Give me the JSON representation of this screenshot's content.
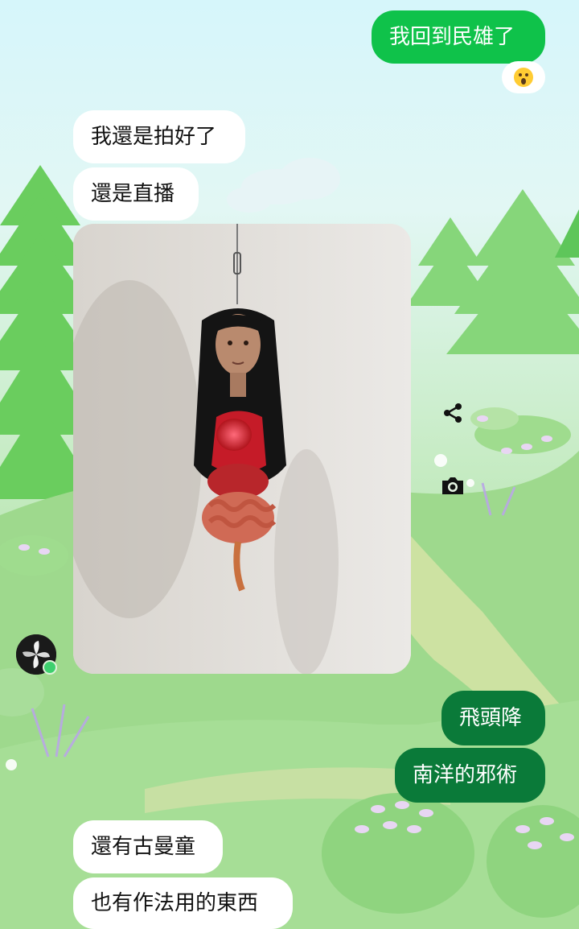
{
  "conversation": {
    "messages": [
      {
        "sender": "me",
        "text": "我回到民雄了"
      },
      {
        "sender": "me",
        "reaction": "surprised-face-emoji"
      },
      {
        "sender": "contact",
        "text": "我還是拍好了"
      },
      {
        "sender": "contact",
        "text": "還是直播"
      },
      {
        "sender": "contact",
        "type": "photo",
        "subject": "hanging-head-with-organs-sculpture"
      },
      {
        "sender": "me",
        "text": "飛頭降"
      },
      {
        "sender": "me",
        "text": "南洋的邪術"
      },
      {
        "sender": "contact",
        "text": "還有古曼童"
      },
      {
        "sender": "contact",
        "text": "也有作法用的東西"
      }
    ]
  },
  "photo_actions": {
    "share_icon": "share-icon",
    "camera_icon": "camera-icon"
  },
  "colors": {
    "outgoing_light": "#0fc24a",
    "outgoing_dark": "#0a7a39",
    "incoming": "#ffffff",
    "online": "#3ed06e"
  }
}
